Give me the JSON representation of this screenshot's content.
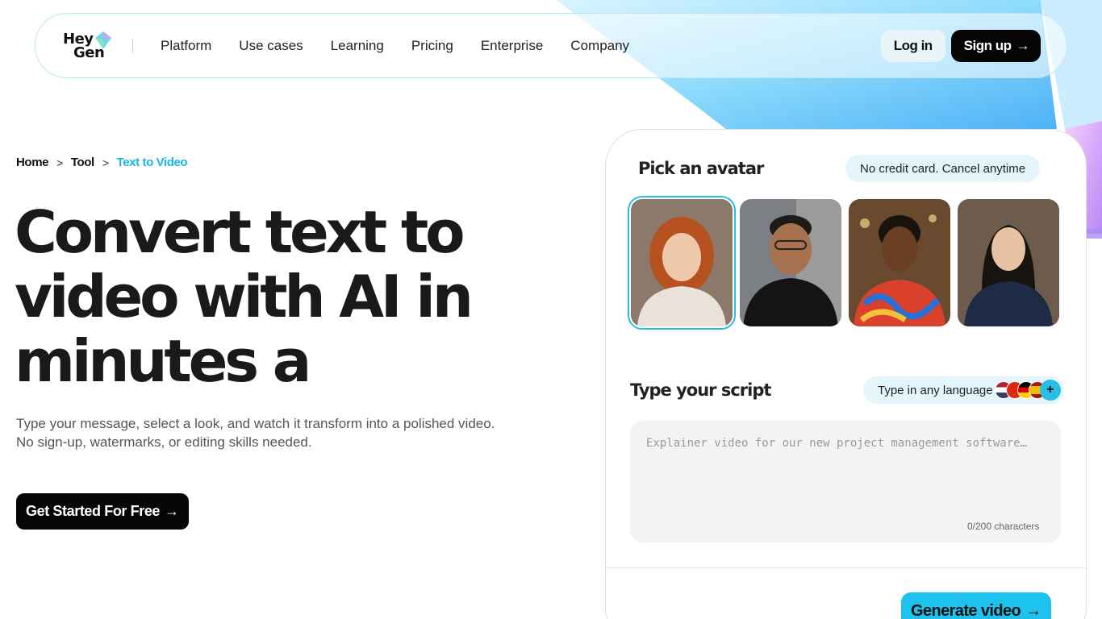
{
  "brand": {
    "logo_line1": "Hey",
    "logo_line2": "Gen",
    "accent": "#1ec2ef"
  },
  "nav": {
    "links": [
      "Platform",
      "Use cases",
      "Learning",
      "Pricing",
      "Enterprise",
      "Company"
    ],
    "login_label": "Log in",
    "signup_label": "Sign up"
  },
  "breadcrumb": [
    "Home",
    "Tool",
    "Text to Video"
  ],
  "hero": {
    "title_line1": "Convert text to",
    "title_line2": "video with AI in",
    "title_line3": "minutes a",
    "subtitle_line1": "Type your message, select a look, and watch it transform into a polished video.",
    "subtitle_line2": "No sign-up, watermarks, or editing skills needed.",
    "cta_label": "Get Started For Free"
  },
  "card": {
    "avatar_heading": "Pick an avatar",
    "avatar_pill": "No credit card. Cancel anytime",
    "avatars": [
      "avatar-1",
      "avatar-2",
      "avatar-3",
      "avatar-4"
    ],
    "script_heading": "Type your script",
    "language_pill": "Type in any language",
    "script_placeholder": "Explainer video for our new project management software…",
    "script_value": "",
    "char_count": "0/200 characters",
    "generate_label": "Generate video"
  }
}
